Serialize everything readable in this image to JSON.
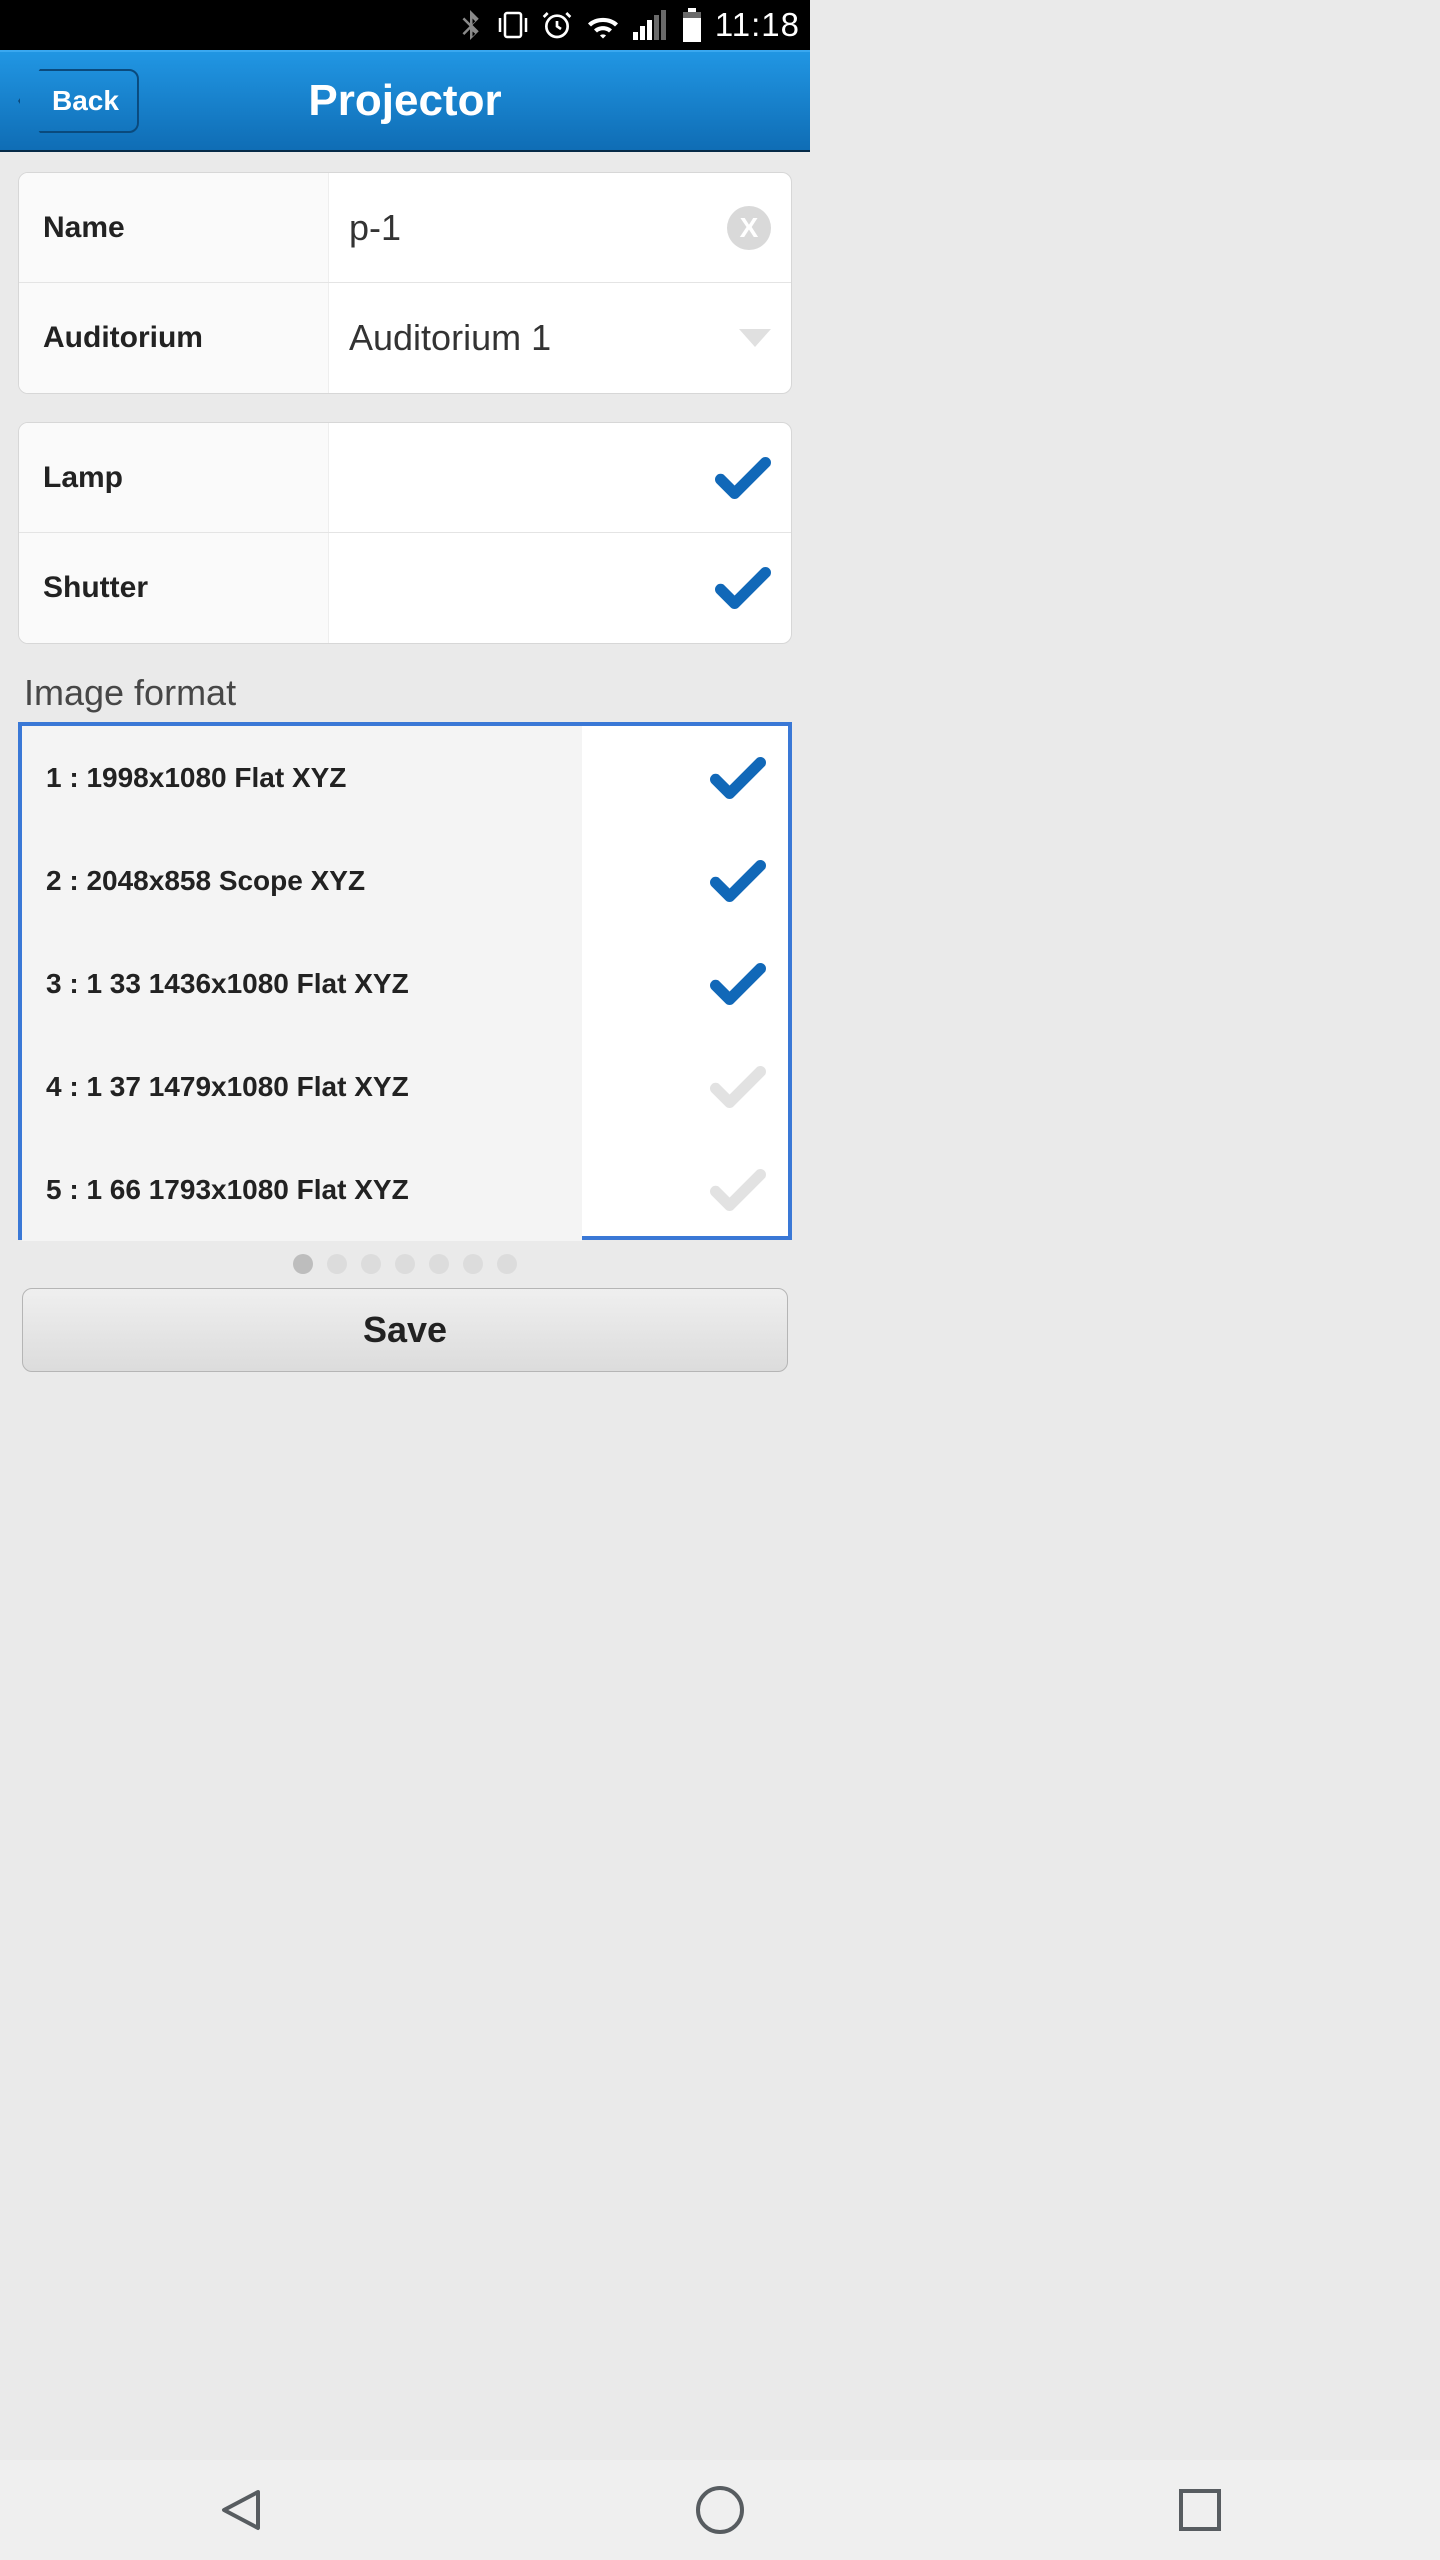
{
  "status": {
    "time": "11:18"
  },
  "header": {
    "back": "Back",
    "title": "Projector"
  },
  "form": {
    "name_label": "Name",
    "name_value": "p-1",
    "auditorium_label": "Auditorium",
    "auditorium_value": "Auditorium 1",
    "lamp_label": "Lamp",
    "lamp_on": true,
    "shutter_label": "Shutter",
    "shutter_on": true
  },
  "image_format": {
    "title": "Image format",
    "items": [
      {
        "label": "1 : 1998x1080 Flat XYZ",
        "on": true
      },
      {
        "label": "2 : 2048x858 Scope XYZ",
        "on": true
      },
      {
        "label": "3 : 1 33 1436x1080 Flat XYZ",
        "on": true
      },
      {
        "label": "4 : 1 37 1479x1080 Flat XYZ",
        "on": false
      },
      {
        "label": "5 : 1 66 1793x1080 Flat XYZ",
        "on": false
      }
    ],
    "pages": 7,
    "active_page": 0
  },
  "save_label": "Save"
}
